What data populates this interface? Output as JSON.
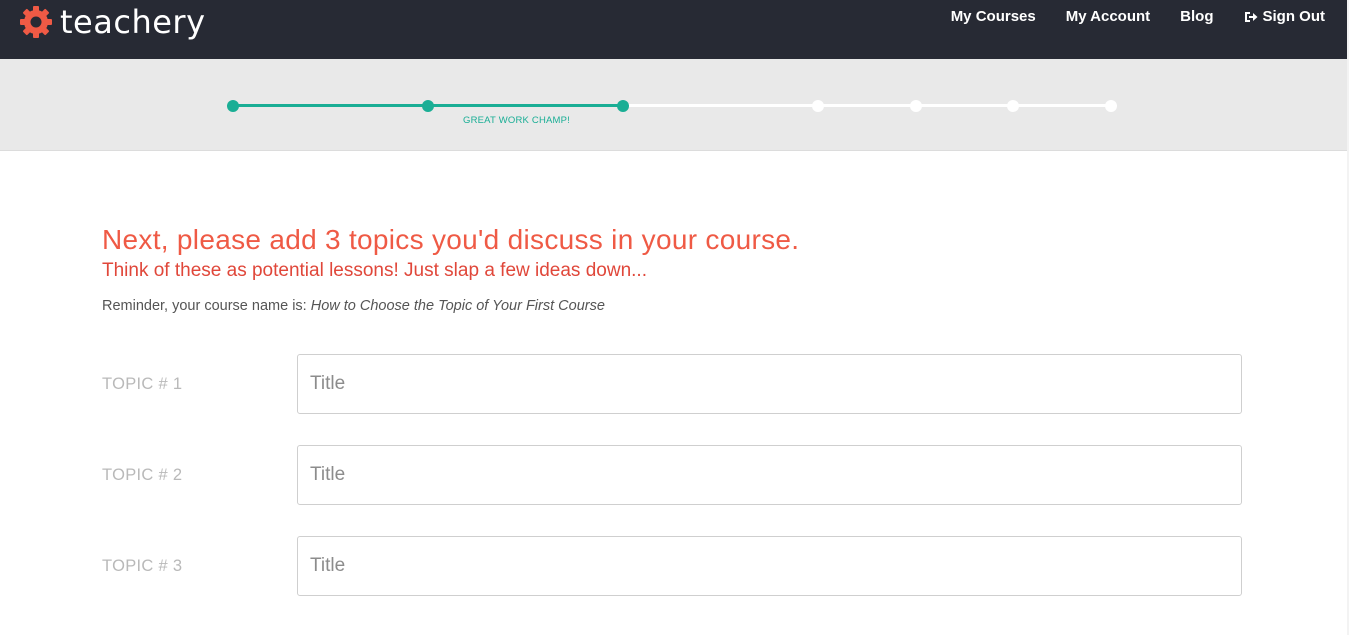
{
  "brand": {
    "name": "teachery",
    "accent_color": "#ef5a45"
  },
  "nav": {
    "items": [
      {
        "label": "My Courses"
      },
      {
        "label": "My Account"
      },
      {
        "label": "Blog"
      },
      {
        "label": "Sign Out",
        "icon": "sign-out-icon"
      }
    ]
  },
  "progress": {
    "total_steps": 7,
    "completed_steps": 3,
    "caption": "GREAT WORK CHAMP!",
    "color_done": "#1aae95"
  },
  "main": {
    "heading": "Next, please add 3 topics you'd discuss in your course.",
    "subheading": "Think of these as potential lessons! Just slap a few ideas down...",
    "reminder_prefix": "Reminder, your course name is: ",
    "course_name": "How to Choose the Topic of Your First Course",
    "topics": [
      {
        "label": "TOPIC # 1",
        "placeholder": "Title",
        "value": ""
      },
      {
        "label": "TOPIC # 2",
        "placeholder": "Title",
        "value": ""
      },
      {
        "label": "TOPIC # 3",
        "placeholder": "Title",
        "value": ""
      }
    ]
  }
}
